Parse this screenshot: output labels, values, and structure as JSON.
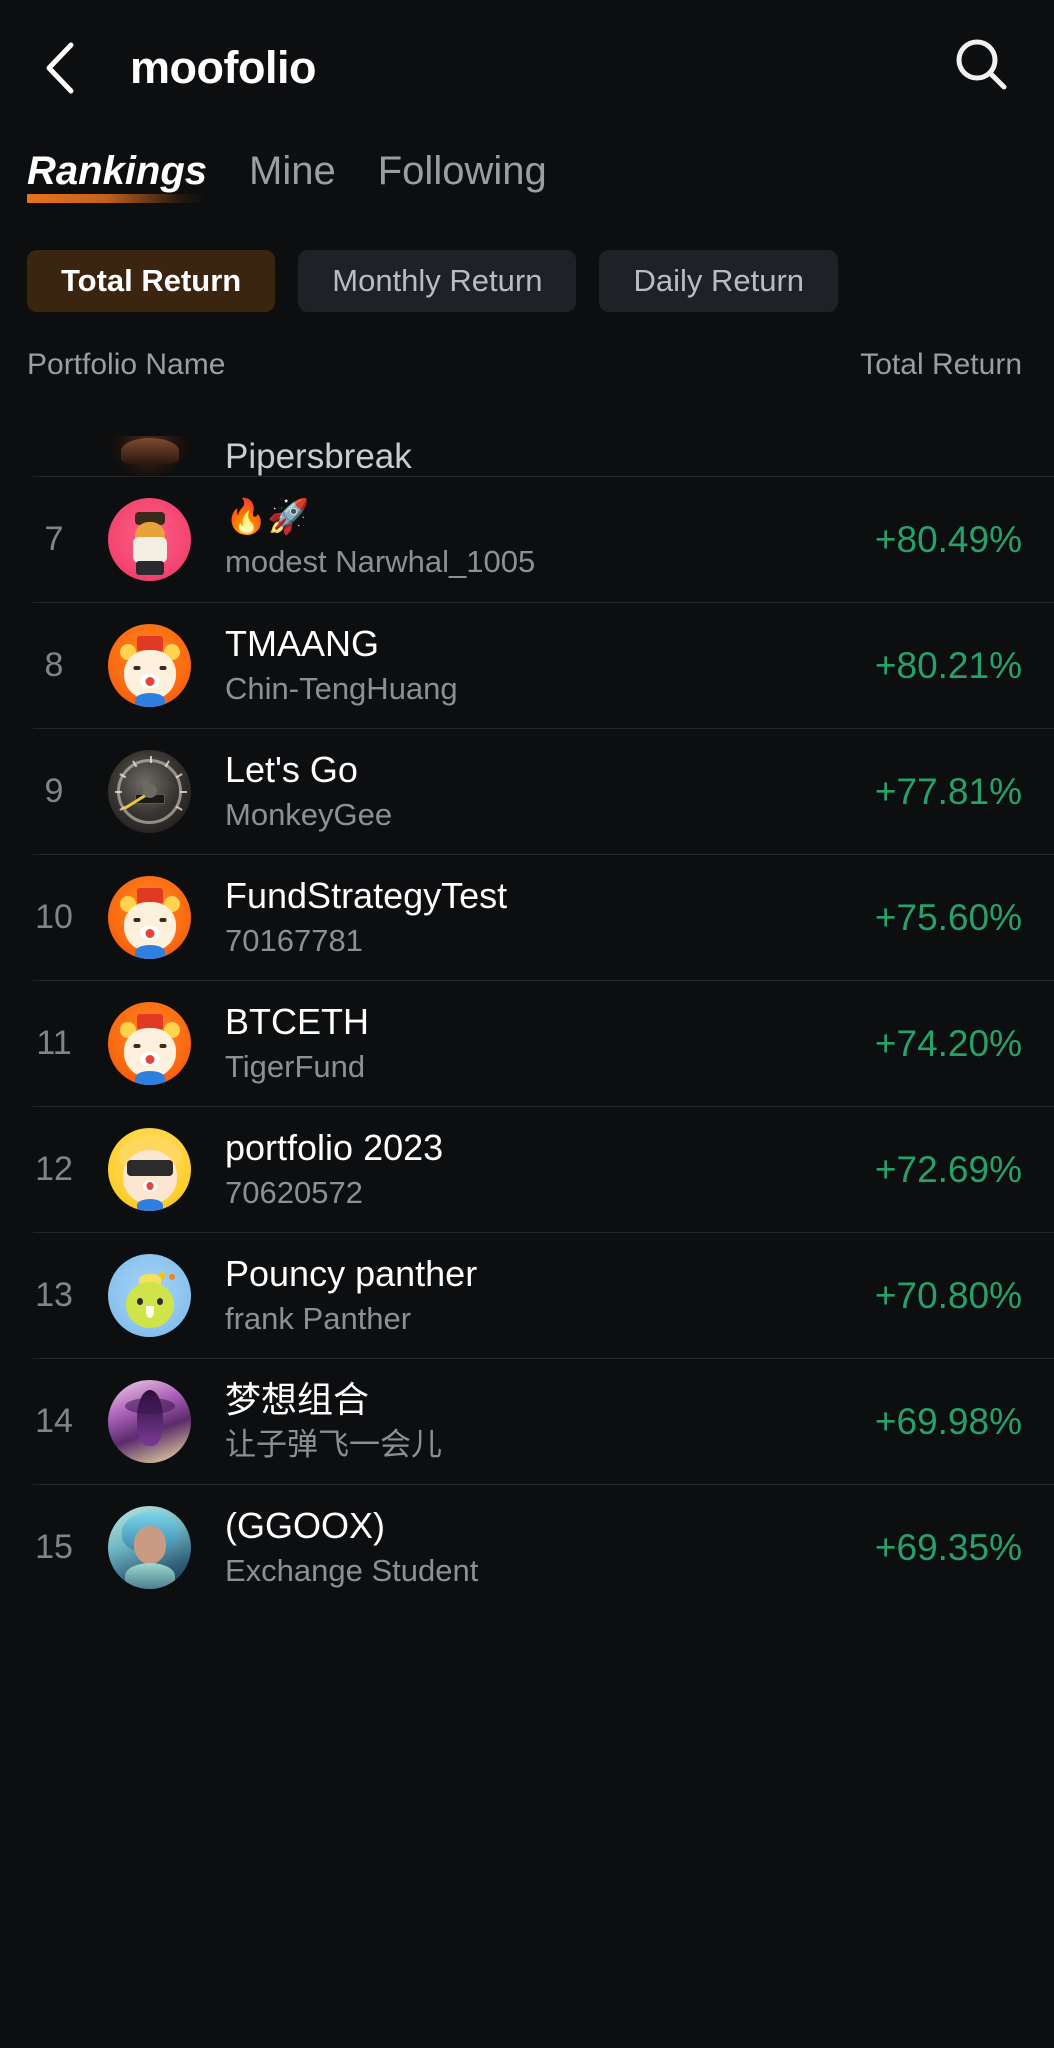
{
  "header": {
    "back_icon": "chevron-left-icon",
    "title": "moofolio",
    "search_icon": "search-icon"
  },
  "tabs": [
    {
      "label": "Rankings",
      "active": true
    },
    {
      "label": "Mine",
      "active": false
    },
    {
      "label": "Following",
      "active": false
    }
  ],
  "filter_chips": [
    {
      "label": "Total Return",
      "active": true
    },
    {
      "label": "Monthly Return",
      "active": false
    },
    {
      "label": "Daily Return",
      "active": false
    }
  ],
  "columns": {
    "name_header": "Portfolio Name",
    "value_header": "Total Return"
  },
  "colors": {
    "background": "#0d0e10",
    "accent_orange": "#e8741c",
    "chip_active_bg": "#3b2410",
    "chip_bg": "#1e2126",
    "positive_green": "#26a269",
    "primary_text": "#ffffff",
    "secondary_text": "#8b8f96",
    "divider": "#23262b"
  },
  "rows": [
    {
      "rank": "",
      "portfolio_name": "Pipersbreak",
      "user_name": "",
      "total_return": "",
      "avatar": "dark-portrait-avatar",
      "partial": true
    },
    {
      "rank": "7",
      "portfolio_name": "🔥🚀",
      "user_name": "modest Narwhal_1005",
      "total_return": "+80.49%",
      "avatar": "pink-character-avatar",
      "partial": false
    },
    {
      "rank": "8",
      "portfolio_name": "TMAANG",
      "user_name": "Chin-TengHuang",
      "total_return": "+80.21%",
      "avatar": "orange-bull-avatar",
      "partial": false
    },
    {
      "rank": "9",
      "portfolio_name": "Let's Go",
      "user_name": "MonkeyGee",
      "total_return": "+77.81%",
      "avatar": "speedometer-avatar",
      "partial": false
    },
    {
      "rank": "10",
      "portfolio_name": "FundStrategyTest",
      "user_name": "70167781",
      "total_return": "+75.60%",
      "avatar": "orange-bull-avatar",
      "partial": false
    },
    {
      "rank": "11",
      "portfolio_name": "BTCETH",
      "user_name": "TigerFund",
      "total_return": "+74.20%",
      "avatar": "orange-bull-avatar",
      "partial": false
    },
    {
      "rank": "12",
      "portfolio_name": "portfolio 2023",
      "user_name": "70620572",
      "total_return": "+72.69%",
      "avatar": "yellow-sunglasses-avatar",
      "partial": false
    },
    {
      "rank": "13",
      "portfolio_name": "Pouncy panther",
      "user_name": "frank Panther",
      "total_return": "+70.80%",
      "avatar": "blue-chick-avatar",
      "partial": false
    },
    {
      "rank": "14",
      "portfolio_name": "梦想组合",
      "user_name": "让子弹飞一会儿",
      "total_return": "+69.98%",
      "avatar": "purple-art-avatar",
      "partial": false
    },
    {
      "rank": "15",
      "portfolio_name": "(GGOOX)",
      "user_name": "Exchange Student",
      "total_return": "+69.35%",
      "avatar": "teal-person-avatar",
      "partial": false
    }
  ]
}
